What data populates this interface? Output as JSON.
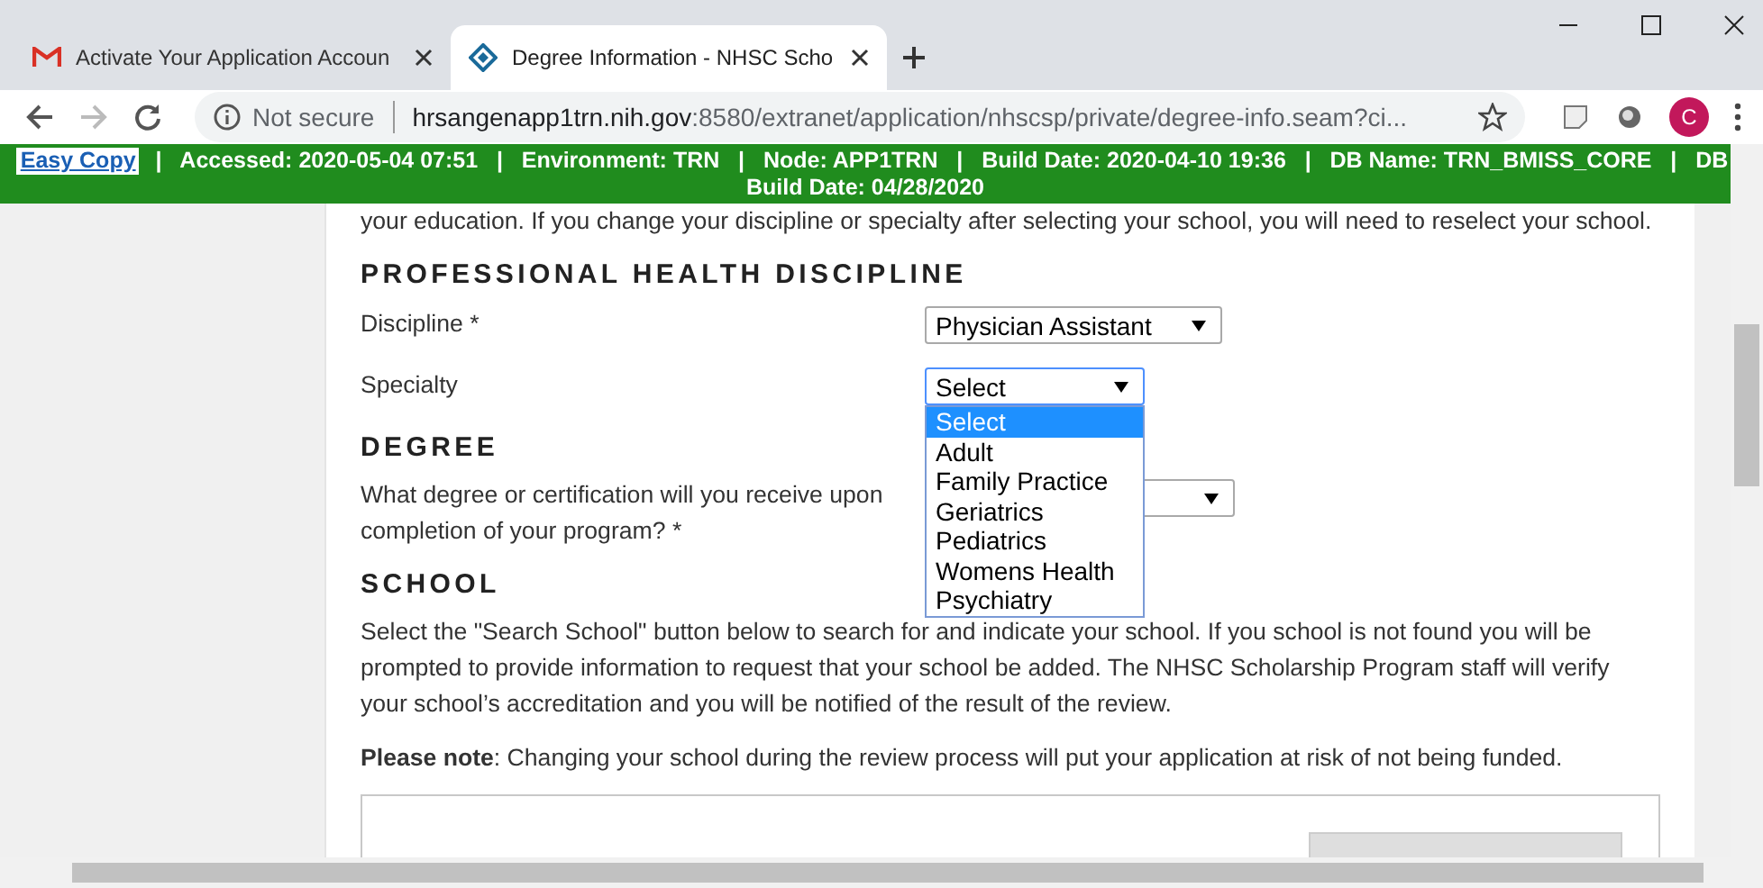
{
  "browser": {
    "tabs": [
      {
        "title": "Activate Your Application Accoun",
        "selected": false
      },
      {
        "title": "Degree Information - NHSC Scho",
        "selected": true
      }
    ],
    "security": "Not secure",
    "url_host": "hrsangenapp1trn.nih.gov",
    "url_rest": ":8580/extranet/application/nhscsp/private/degree-info.seam?ci...",
    "profile": "C"
  },
  "banner": {
    "link": "Easy Copy",
    "line_1": "  |   Accessed: 2020-05-04 07:51   |   Environment: TRN   |   Node: APP1TRN   |   Build Date: 2020-04-10 19:36   |   DB Name: TRN_BMISS_CORE   |   DB",
    "line_2": "Build Date: 04/28/2020"
  },
  "intro": "your education. If you change your discipline or specialty after selecting your school, you will need to reselect your school.",
  "discipline_section": {
    "heading": "PROFESSIONAL HEALTH DISCIPLINE",
    "discipline": {
      "label": "Discipline *",
      "value": "Physician Assistant"
    },
    "specialty": {
      "label": "Specialty",
      "value": "Select",
      "expanded": true,
      "options": [
        {
          "label": "Select",
          "selected": true
        },
        {
          "label": "Adult",
          "selected": false
        },
        {
          "label": "Family Practice",
          "selected": false
        },
        {
          "label": "Geriatrics",
          "selected": false
        },
        {
          "label": "Pediatrics",
          "selected": false
        },
        {
          "label": "Womens Health",
          "selected": false
        },
        {
          "label": "Psychiatry",
          "selected": false
        }
      ]
    }
  },
  "degree_section": {
    "heading": "DEGREE",
    "question": "What degree or certification will you receive upon completion of your program? *"
  },
  "school_section": {
    "heading": "SCHOOL",
    "text": "Select the \"Search School\" button below to search for and indicate your school. If you school is not found you will be prompted to provide information to request that your school be added. The NHSC Scholarship Program staff will verify your school’s accreditation and you will be notified of the result of the review.",
    "note": "**Please note**: Changing your school during the review process will put your application at risk of not being funded."
  }
}
